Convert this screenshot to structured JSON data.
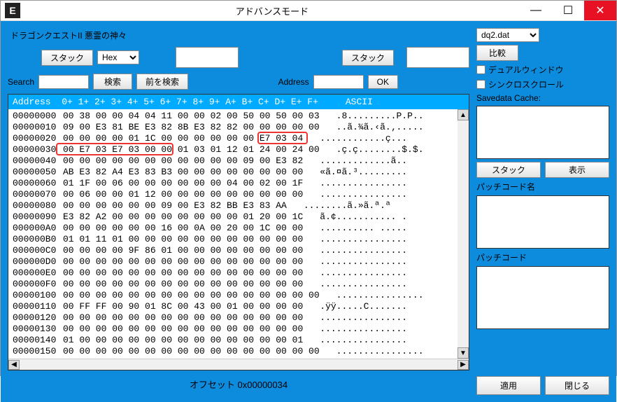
{
  "window": {
    "title": "アドバンスモード",
    "icon": "E",
    "minimize": "—",
    "maximize": "☐",
    "close": "✕"
  },
  "subtitle": "ドラゴンクエストII 悪霊の神々",
  "controls": {
    "stack_btn": "スタック",
    "format_select": "Hex",
    "search_label": "Search",
    "search_btn": "検索",
    "search_prev_btn": "前を検索",
    "address_label": "Address",
    "ok_btn": "OK"
  },
  "hex": {
    "header_address": "Address",
    "header_cols": [
      "0+",
      "1+",
      "2+",
      "3+",
      "4+",
      "5+",
      "6+",
      "7+",
      "8+",
      "9+",
      "A+",
      "B+",
      "C+",
      "D+",
      "E+",
      "F+"
    ],
    "header_ascii": "ASCII",
    "rows": [
      {
        "addr": "00000000",
        "bytes": [
          "00",
          "38",
          "00",
          "00",
          "04",
          "04",
          "11",
          "00",
          "00",
          "02",
          "00",
          "50",
          "00",
          "50",
          "00",
          "03"
        ],
        "ascii": ".8.........P.P.."
      },
      {
        "addr": "00000010",
        "bytes": [
          "09",
          "00",
          "E3",
          "81",
          "BE",
          "E3",
          "82",
          "8B",
          "E3",
          "82",
          "82",
          "00",
          "00",
          "00",
          "00",
          "00"
        ],
        "ascii": "..ã.¾ã.‹ã.‚....."
      },
      {
        "addr": "00000020",
        "bytes": [
          "00",
          "00",
          "00",
          "00",
          "01",
          "1C",
          "00",
          "00",
          "00",
          "00",
          "00",
          "00",
          "E7",
          "03",
          "04"
        ],
        "ascii": "............ç..."
      },
      {
        "addr": "00000030",
        "bytes": [
          "00",
          "E7",
          "03",
          "E7",
          "03",
          "00",
          "00",
          "01",
          "03",
          "01",
          "12",
          "01",
          "24",
          "00",
          "24",
          "00"
        ],
        "ascii": ".ç.ç........$.$."
      },
      {
        "addr": "00000040",
        "bytes": [
          "00",
          "00",
          "00",
          "00",
          "00",
          "00",
          "00",
          "00",
          "00",
          "00",
          "00",
          "09",
          "00",
          "E3",
          "82"
        ],
        "ascii": ".............ã.."
      },
      {
        "addr": "00000050",
        "bytes": [
          "AB",
          "E3",
          "82",
          "A4",
          "E3",
          "83",
          "B3",
          "00",
          "00",
          "00",
          "00",
          "00",
          "00",
          "00",
          "00"
        ],
        "ascii": "«ã.¤ã.³........."
      },
      {
        "addr": "00000060",
        "bytes": [
          "01",
          "1F",
          "00",
          "06",
          "00",
          "00",
          "00",
          "00",
          "00",
          "00",
          "04",
          "00",
          "02",
          "00",
          "1F"
        ],
        "ascii": "................"
      },
      {
        "addr": "00000070",
        "bytes": [
          "00",
          "06",
          "00",
          "00",
          "01",
          "12",
          "00",
          "00",
          "00",
          "00",
          "00",
          "00",
          "00",
          "00",
          "00"
        ],
        "ascii": "................"
      },
      {
        "addr": "00000080",
        "bytes": [
          "00",
          "00",
          "00",
          "00",
          "00",
          "00",
          "09",
          "00",
          "E3",
          "82",
          "BB",
          "E3",
          "83",
          "AA"
        ],
        "ascii": "........ã.»ã.ª.ª"
      },
      {
        "addr": "00000090",
        "bytes": [
          "E3",
          "82",
          "A2",
          "00",
          "00",
          "00",
          "00",
          "00",
          "00",
          "00",
          "00",
          "01",
          "20",
          "00",
          "1C"
        ],
        "ascii": "ã.¢........... ."
      },
      {
        "addr": "000000A0",
        "bytes": [
          "00",
          "00",
          "00",
          "00",
          "00",
          "00",
          "16",
          "00",
          "0A",
          "00",
          "20",
          "00",
          "1C",
          "00",
          "00"
        ],
        "ascii": ".......... ....."
      },
      {
        "addr": "000000B0",
        "bytes": [
          "01",
          "01",
          "11",
          "01",
          "00",
          "00",
          "00",
          "00",
          "00",
          "00",
          "00",
          "00",
          "00",
          "00",
          "00"
        ],
        "ascii": "................"
      },
      {
        "addr": "000000C0",
        "bytes": [
          "00",
          "00",
          "00",
          "00",
          "9F",
          "86",
          "01",
          "00",
          "00",
          "00",
          "00",
          "00",
          "00",
          "00",
          "00"
        ],
        "ascii": "................"
      },
      {
        "addr": "000000D0",
        "bytes": [
          "00",
          "00",
          "00",
          "00",
          "00",
          "00",
          "00",
          "00",
          "00",
          "00",
          "00",
          "00",
          "00",
          "00",
          "00"
        ],
        "ascii": "................"
      },
      {
        "addr": "000000E0",
        "bytes": [
          "00",
          "00",
          "00",
          "00",
          "00",
          "00",
          "00",
          "00",
          "00",
          "00",
          "00",
          "00",
          "00",
          "00",
          "00"
        ],
        "ascii": "................"
      },
      {
        "addr": "000000F0",
        "bytes": [
          "00",
          "00",
          "00",
          "00",
          "00",
          "00",
          "00",
          "00",
          "00",
          "00",
          "00",
          "00",
          "00",
          "00",
          "00"
        ],
        "ascii": "................"
      },
      {
        "addr": "00000100",
        "bytes": [
          "00",
          "00",
          "00",
          "00",
          "00",
          "00",
          "00",
          "00",
          "00",
          "00",
          "00",
          "00",
          "00",
          "00",
          "00",
          "00"
        ],
        "ascii": "................"
      },
      {
        "addr": "00000110",
        "bytes": [
          "00",
          "FF",
          "FF",
          "00",
          "90",
          "01",
          "8C",
          "00",
          "43",
          "00",
          "01",
          "00",
          "00",
          "00",
          "00"
        ],
        "ascii": ".ÿÿ.....C......."
      },
      {
        "addr": "00000120",
        "bytes": [
          "00",
          "00",
          "00",
          "00",
          "00",
          "00",
          "00",
          "00",
          "00",
          "00",
          "00",
          "00",
          "00",
          "00",
          "00"
        ],
        "ascii": "................"
      },
      {
        "addr": "00000130",
        "bytes": [
          "00",
          "00",
          "00",
          "00",
          "00",
          "00",
          "00",
          "00",
          "00",
          "00",
          "00",
          "00",
          "00",
          "00",
          "00"
        ],
        "ascii": "................"
      },
      {
        "addr": "00000140",
        "bytes": [
          "01",
          "00",
          "00",
          "00",
          "00",
          "00",
          "00",
          "00",
          "00",
          "00",
          "00",
          "00",
          "00",
          "00",
          "01"
        ],
        "ascii": "................"
      },
      {
        "addr": "00000150",
        "bytes": [
          "00",
          "00",
          "00",
          "00",
          "00",
          "00",
          "00",
          "00",
          "00",
          "00",
          "00",
          "00",
          "00",
          "00",
          "00",
          "00"
        ],
        "ascii": "................"
      }
    ],
    "offset_label": "オフセット 0x00000034"
  },
  "side": {
    "file_select": "dq2.dat",
    "compare_btn": "比較",
    "dual_window": "デュアルウィンドウ",
    "sync_scroll": "シンクロスクロール",
    "savedata_cache": "Savedata Cache:",
    "stack_btn": "スタック",
    "show_btn": "表示",
    "patch_name_label": "パッチコード名",
    "patch_code_label": "パッチコード",
    "apply_btn": "適用",
    "close_btn": "閉じる"
  }
}
